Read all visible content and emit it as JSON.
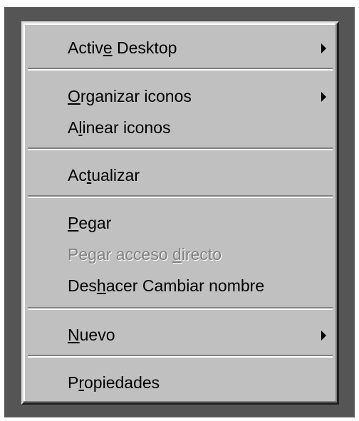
{
  "colors": {
    "menu_bg": "#c0c0c0",
    "desktop_bg": "#555555",
    "disabled_text": "#808080"
  },
  "menu": {
    "items": [
      {
        "pre": "Activ",
        "acc": "e",
        "post": " Desktop",
        "submenu": true,
        "arrow_icon": "triangle-right-icon"
      },
      {
        "pre": "",
        "acc": "O",
        "post": "rganizar iconos",
        "submenu": true,
        "arrow_icon": "triangle-right-icon"
      },
      {
        "pre": "A",
        "acc": "l",
        "post": "inear iconos"
      },
      {
        "pre": "Ac",
        "acc": "t",
        "post": "ualizar"
      },
      {
        "pre": "",
        "acc": "P",
        "post": "egar"
      },
      {
        "pre": "Pegar acceso ",
        "acc": "d",
        "post": "irecto",
        "disabled": true
      },
      {
        "pre": "Des",
        "acc": "h",
        "post": "acer Cambiar nombre"
      },
      {
        "pre": "",
        "acc": "N",
        "post": "uevo",
        "submenu": true,
        "arrow_icon": "triangle-right-icon"
      },
      {
        "pre": "P",
        "acc": "r",
        "post": "opiedades"
      }
    ]
  }
}
